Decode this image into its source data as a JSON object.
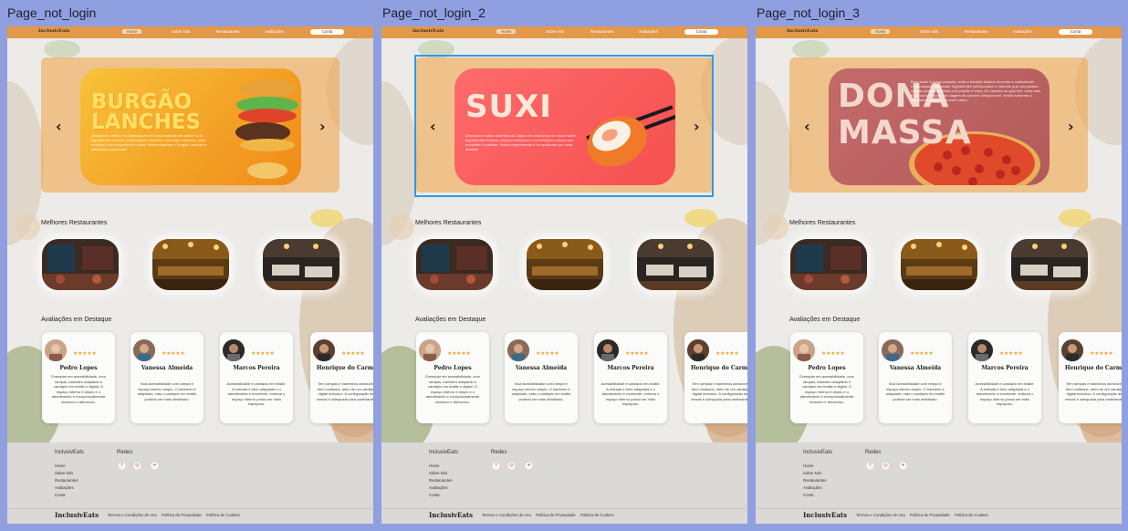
{
  "frames": [
    {
      "label": "Page_not_login",
      "nav": {
        "logo": "InclusivEats",
        "links": [
          "Home",
          "Sobre Nós",
          "Restaurantes",
          "Avaliações"
        ],
        "cta": "Conta"
      },
      "hero": {
        "title_line1": "BURGÃO",
        "title_line2": "LANCHES",
        "desc": "Descubra o melhor do hambúrguer em uma explosão de sabor! Com ingredientes frescos, combinações criativas e um toque especial, cada mordida é uma experiência única. Venha saborear o Burgão Lanches e satisfazer a sua fome!",
        "colors": {
          "from": "#f8c23a",
          "to": "#f08a18"
        }
      },
      "selected": false
    },
    {
      "label": "Page_not_login_2",
      "nav": {
        "logo": "InclusivEats",
        "links": [
          "Home",
          "Sobre Nós",
          "Restaurantes",
          "Avaliações"
        ],
        "cta": "Conta"
      },
      "hero": {
        "title_line1": "SUXI",
        "title_line2": "",
        "desc": "Descubra o sabor autêntico do Japão em cada peça do nosso sushi. Ingredientes frescos, preparo artesanal e combinações únicas que encantam o paladar. Venha experimentar e se apaixonar por cada detalhe!",
        "colors": {
          "from": "#ff6b6b",
          "to": "#f4504f"
        }
      },
      "selected": true
    },
    {
      "label": "Page_not_login_3",
      "nav": {
        "logo": "InclusivEats",
        "links": [
          "Home",
          "Sobre Nós",
          "Restaurantes",
          "Avaliações"
        ],
        "cta": "Conta"
      },
      "hero": {
        "title_line1": "DONA",
        "title_line2": "MASSA",
        "desc": "Bem-vindo à nossa pizzaria, onde a tradição italiana encontra a criatividade! Com massas artesanais, ingredientes selecionados e sabores que conquistam, nossas pizzas são feitas com paixão e amor. Do clássico ao gourmet, cada fatia é um convite para uma viagem de sabores inesquecível. Venha saborear a verdadeira pizza e viva esse sabor!",
        "colors": {
          "from": "#c46a6a",
          "to": "#b35a5a"
        }
      },
      "selected": false
    }
  ],
  "sections": {
    "restaurants": "Melhores Restaurantes",
    "reviews": "Avaliações em Destaque"
  },
  "reviews": [
    {
      "name": "Pedro Lopes",
      "stars": "★★★★★",
      "text": "Exemplar em acessibilidade, com rampas, banheiro adaptado e cardápio em braille e digital. O espaço interno é amplo e o atendimento é excepcionalmente inclusivo e atencioso."
    },
    {
      "name": "Vanessa Almeida",
      "stars": "★★★★★",
      "text": "Boa acessibilidade com rampa e espaço interno amplo. O banheiro é adaptado, mas o cardápio em braille poderia ser mais detalhado."
    },
    {
      "name": "Marcos Pereira",
      "stars": "★★★★★",
      "text": "Acessibilidade e cardápio em braille. A entrada é bem adaptada e o atendimento é excelente, embora o espaço interno possa ser mais espaçoso."
    },
    {
      "name": "Henrique do Carmo",
      "stars": "★★★★★",
      "text": "Tem rampas e banheiros acessíveis bem cuidados, além de um cardápio digital inclusivo. A configuração das mesas é adequada para cadeirantes."
    }
  ],
  "footer": {
    "brand": "InclusivEats",
    "nav_links": [
      "Home",
      "Sobre Nós",
      "Restaurantes",
      "Avaliações",
      "Conta"
    ],
    "social_title": "Redes",
    "bottom_logo": "InclusivEats",
    "bottom_links": [
      "Termos e Condições de Uso",
      "Política de Privacidade",
      "Política de Cookies"
    ]
  }
}
